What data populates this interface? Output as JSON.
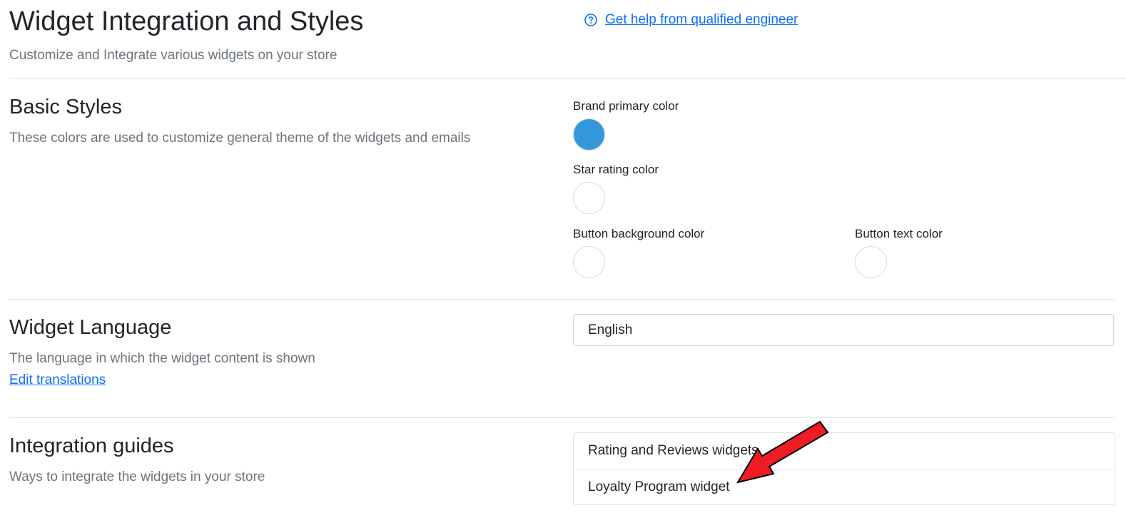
{
  "header": {
    "title": "Widget Integration and Styles",
    "subtitle": "Customize and Integrate various widgets on your store",
    "help_link": "Get help from qualified engineer",
    "help_icon": "question-circle-icon"
  },
  "basic_styles": {
    "title": "Basic Styles",
    "description": "These colors are used to customize general theme of the widgets and emails",
    "colors": [
      {
        "label": "Brand primary color",
        "value": "#3498db"
      },
      {
        "label": "Star rating color",
        "value": "#ffffff"
      },
      {
        "label": "Button background color",
        "value": "#ffffff"
      },
      {
        "label": "Button text color",
        "value": "#ffffff"
      }
    ]
  },
  "widget_language": {
    "title": "Widget Language",
    "description": "The language in which the widget content is shown",
    "edit_link": "Edit translations",
    "selected": "English"
  },
  "integration_guides": {
    "title": "Integration guides",
    "description": "Ways to integrate the widgets in your store",
    "items": [
      "Rating and Reviews widgets",
      "Loyalty Program widget"
    ]
  },
  "annotation": {
    "arrow_color": "#ee1c24",
    "arrow_icon": "red-arrow-annotation"
  }
}
